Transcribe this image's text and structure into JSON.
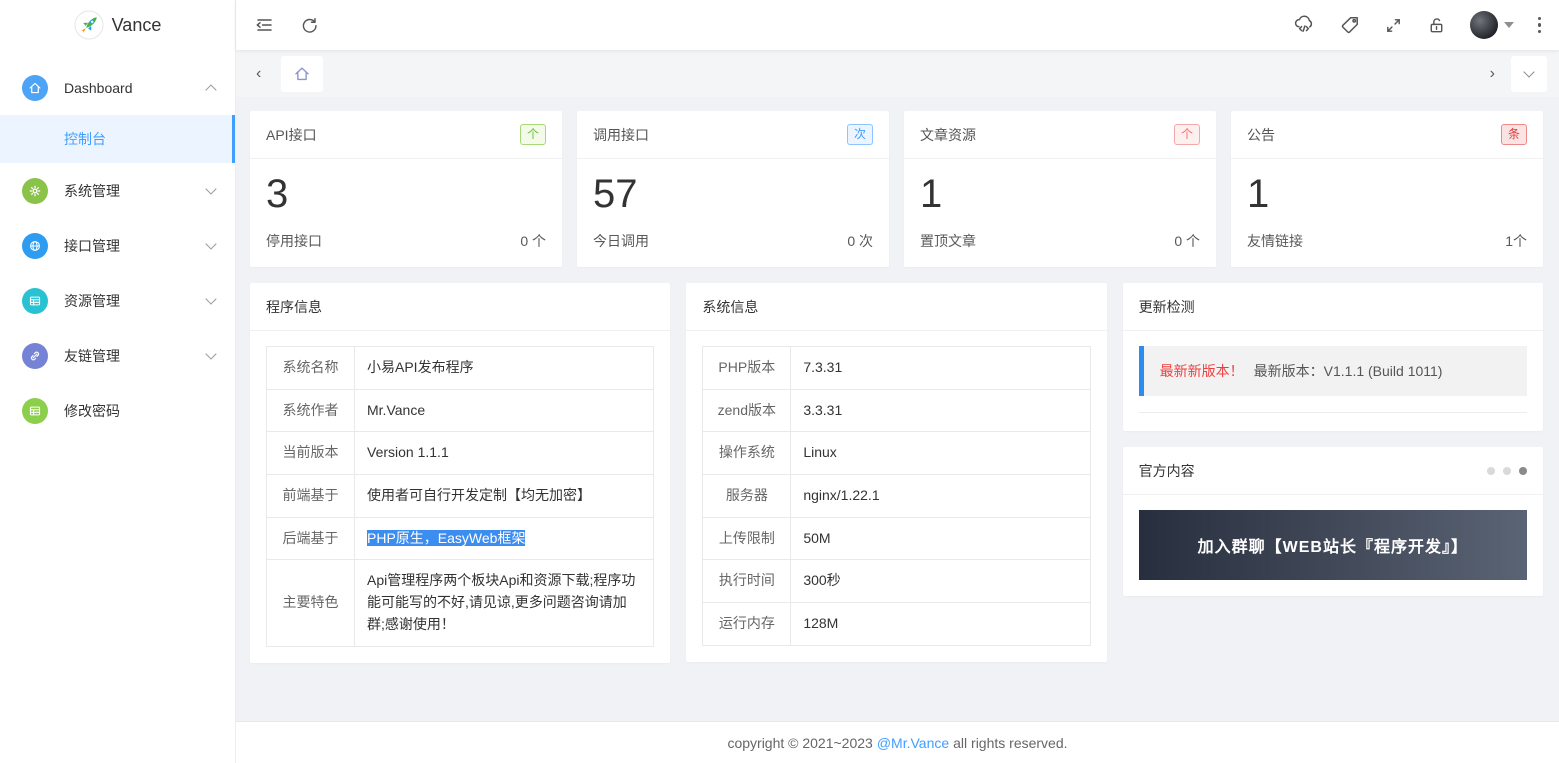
{
  "colors": {
    "accent_blue": "#409eff",
    "success_green": "#67c23a",
    "danger_red": "#f56c6c",
    "alert_bar_blue": "#2d8cf0",
    "selection_blue": "#3c8df0",
    "banner_gradient": [
      "#272e3e",
      "#5b6474"
    ]
  },
  "sidebar": {
    "brand": "Vance",
    "items": [
      {
        "label": "Dashboard",
        "icon": "home-icon",
        "expanded": true,
        "children": [
          {
            "label": "控制台",
            "active": true
          }
        ]
      },
      {
        "label": "系统管理",
        "icon": "gear-icon"
      },
      {
        "label": "接口管理",
        "icon": "globe-icon"
      },
      {
        "label": "资源管理",
        "icon": "table-icon"
      },
      {
        "label": "友链管理",
        "icon": "link-icon"
      },
      {
        "label": "修改密码",
        "icon": "table-icon"
      }
    ]
  },
  "header": {
    "left_icons": [
      "collapse-sidebar-icon",
      "refresh-icon"
    ],
    "right_icons": [
      "cloud-api-icon",
      "tag-icon",
      "fullscreen-icon",
      "lock-icon",
      "avatar",
      "caret-down-icon",
      "kebab-menu-icon"
    ]
  },
  "tabs": {
    "home_tab_icon": "home-icon",
    "nav": [
      "scroll-left",
      "scroll-right",
      "tab-actions-dropdown"
    ]
  },
  "stats": [
    {
      "title": "API接口",
      "unit_badge": "个",
      "badge_style": "green",
      "value": "3",
      "footer_label": "停用接口",
      "footer_value": "0 个"
    },
    {
      "title": "调用接口",
      "unit_badge": "次",
      "badge_style": "blue",
      "value": "57",
      "footer_label": "今日调用",
      "footer_value": "0 次"
    },
    {
      "title": "文章资源",
      "unit_badge": "个",
      "badge_style": "red-light",
      "value": "1",
      "footer_label": "置顶文章",
      "footer_value": "0 个"
    },
    {
      "title": "公告",
      "unit_badge": "条",
      "badge_style": "red",
      "value": "1",
      "footer_label": "友情链接",
      "footer_value": "1个"
    }
  ],
  "program_info": {
    "title": "程序信息",
    "rows": [
      {
        "label": "系统名称",
        "value": "小易API发布程序"
      },
      {
        "label": "系统作者",
        "value": "Mr.Vance"
      },
      {
        "label": "当前版本",
        "value": "Version 1.1.1"
      },
      {
        "label": "前端基于",
        "value": "使用者可自行开发定制【均无加密】"
      },
      {
        "label": "后端基于",
        "value": "PHP原生，EasyWeb框架",
        "selected": true
      },
      {
        "label": "主要特色",
        "value": "Api管理程序两个板块Api和资源下载;程序功能可能写的不好,请见谅,更多问题咨询请加群;感谢使用！"
      }
    ]
  },
  "system_info": {
    "title": "系统信息",
    "rows": [
      {
        "label": "PHP版本",
        "value": "7.3.31"
      },
      {
        "label": "zend版本",
        "value": "3.3.31"
      },
      {
        "label": "操作系统",
        "value": "Linux"
      },
      {
        "label": "服务器",
        "value": "nginx/1.22.1"
      },
      {
        "label": "上传限制",
        "value": "50M"
      },
      {
        "label": "执行时间",
        "value": "300秒"
      },
      {
        "label": "运行内存",
        "value": "128M"
      }
    ]
  },
  "update_check": {
    "title": "更新检测",
    "alert_highlight": "最新新版本！",
    "alert_text": "最新版本：V1.1.1 (Build 1011)"
  },
  "official": {
    "title": "官方内容",
    "banner_text": "加入群聊【WEB站长『程序开发』】",
    "carousel_dots": 3,
    "active_dot_index": 2
  },
  "footer": {
    "prefix": "copyright © 2021~2023",
    "link_text": "@Mr.Vance",
    "suffix": "all rights reserved."
  }
}
